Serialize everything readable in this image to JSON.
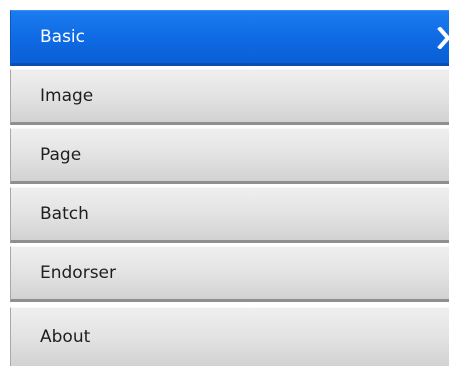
{
  "menu": {
    "active_index": 0,
    "items": [
      {
        "label": "Basic"
      },
      {
        "label": "Image"
      },
      {
        "label": "Page"
      },
      {
        "label": "Batch"
      },
      {
        "label": "Endorser"
      },
      {
        "label": "About"
      }
    ]
  },
  "colors": {
    "active_bg": "#0f6be4",
    "active_text": "#ffffff",
    "item_bg": "#e3e3e3",
    "item_text": "#1e1e1e"
  },
  "icons": {
    "active_indicator": "chevron-right-icon"
  }
}
